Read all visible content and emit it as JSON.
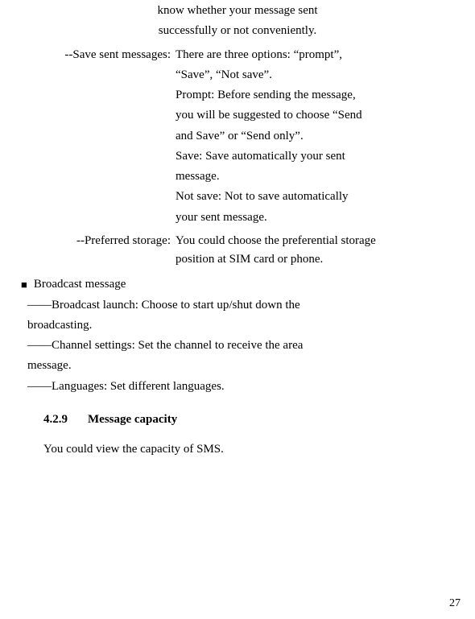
{
  "top": {
    "line1": "know  whether  your  message   sent",
    "line2": "successfully or not conveniently."
  },
  "save_block": {
    "label": "--Save  sent  messages:",
    "options_intro": " There  are  three  options:  “prompt”,",
    "options_line2": "“Save”, “Not save”.",
    "prompt_label": "Prompt:",
    "prompt_text": " Before  sending  the  message,",
    "prompt_line2": "you will be suggested to choose “Send",
    "prompt_line3": "and Save” or “Send only”.",
    "save_label": "Save:",
    "save_text": "  Save   automatically   your   sent",
    "save_line2": "message.",
    "notsave_label": "Not  save:",
    "notsave_text": "  Not  to  save  automatically",
    "notsave_line2": "your sent message."
  },
  "preferred": {
    "label": "--Preferred storage:",
    "text": "You could choose the preferential storage",
    "line2": "position at SIM card or phone."
  },
  "broadcast": {
    "heading": "Broadcast message",
    "launch_label": "——Broadcast",
    "launch_text": " launch:  Choose  to  start  up/shut  down  the",
    "launch_cont": "broadcasting.",
    "channel_label": "——Channel",
    "channel_text": " settings:  Set  the  channel  to  receive  the  area",
    "channel_cont": "message.",
    "lang_label": "——Languages:",
    "lang_text": " Set different languages."
  },
  "section": {
    "num": "4.2.9",
    "title": "Message capacity",
    "body": "You could view the capacity of SMS."
  },
  "page_number": "27"
}
